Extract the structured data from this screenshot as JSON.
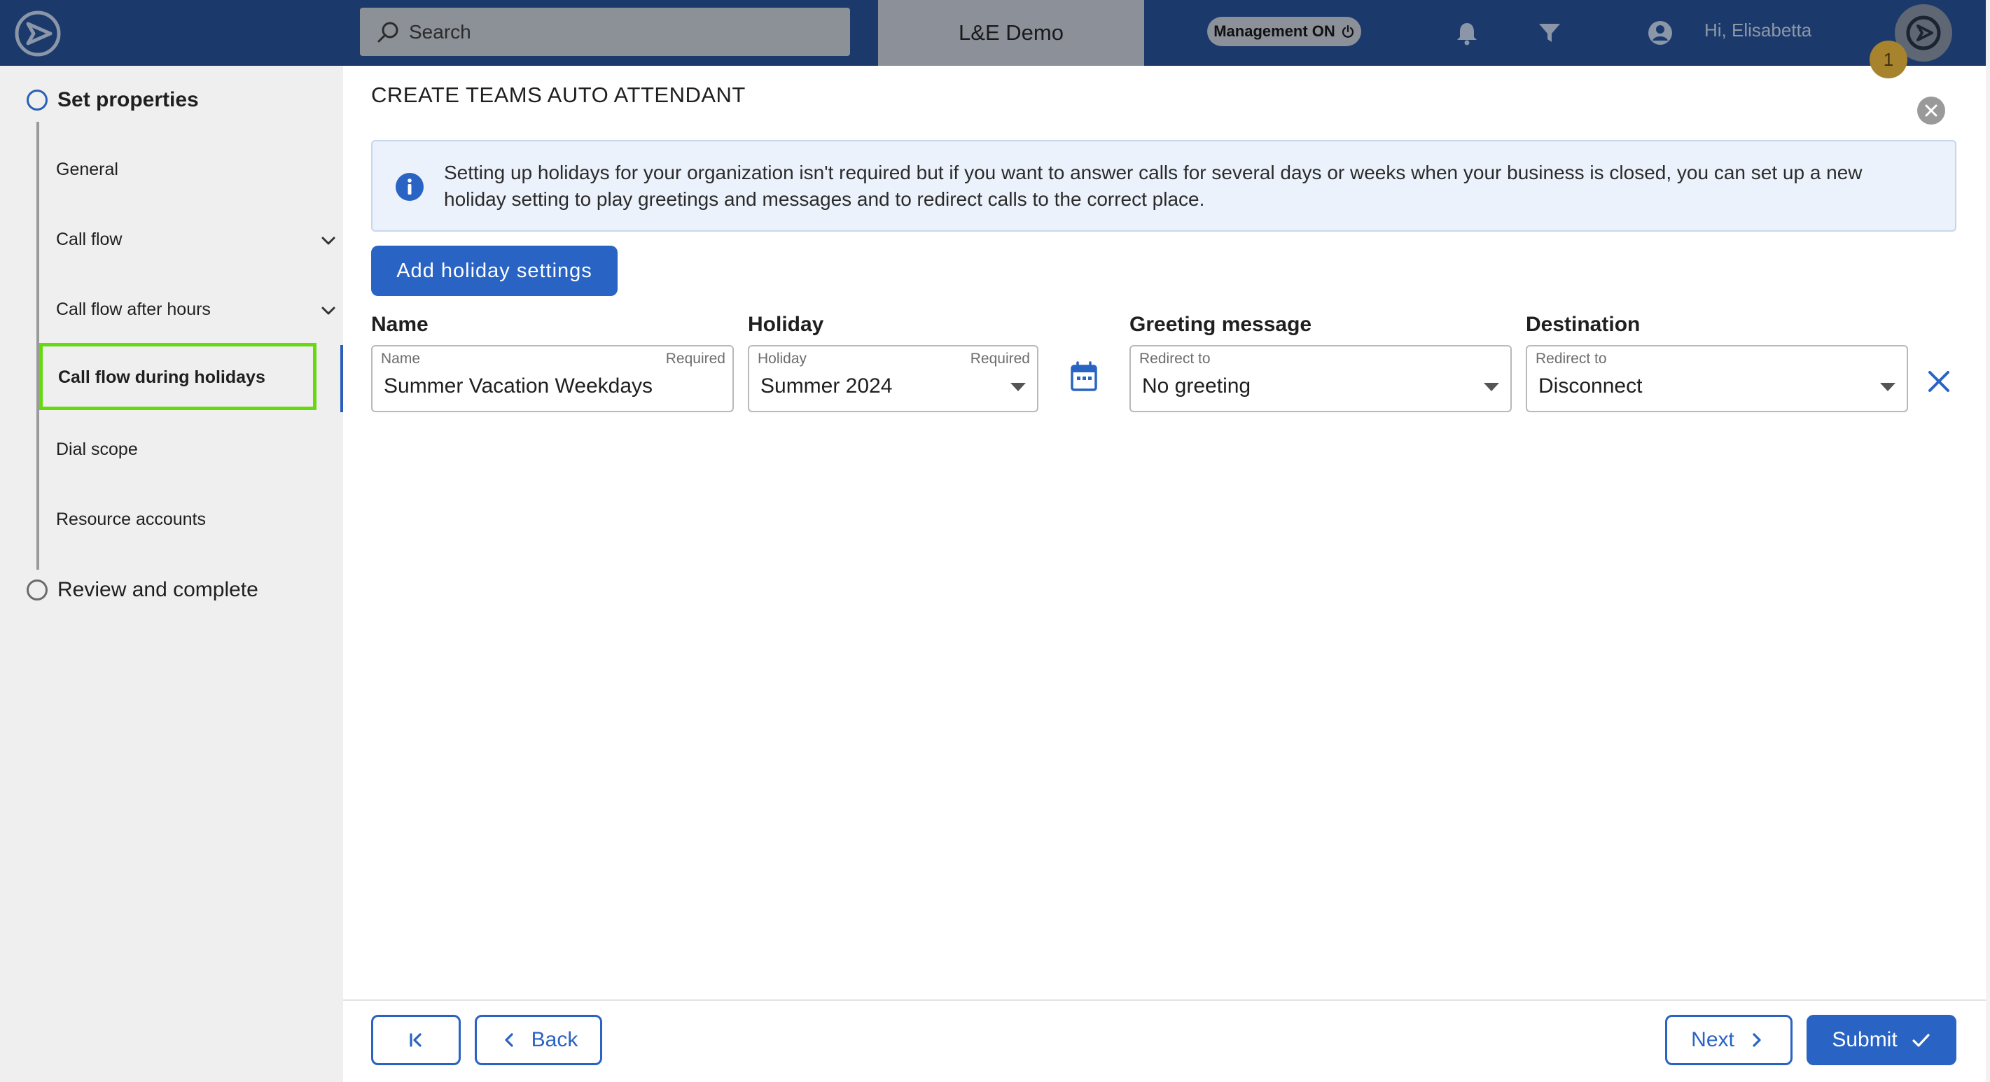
{
  "header": {
    "search_placeholder": "Search",
    "tenant_name": "L&E Demo",
    "management_label": "Management ON",
    "greeting": "Hi, Elisabetta",
    "notification_count": "1"
  },
  "sidebar": {
    "steps": [
      {
        "label": "Set properties",
        "active": true
      },
      {
        "label": "Review and complete",
        "active": false
      }
    ],
    "items": [
      {
        "label": "General"
      },
      {
        "label": "Call flow",
        "expandable": true
      },
      {
        "label": "Call flow after hours",
        "expandable": true
      },
      {
        "label": "Call flow during holidays",
        "selected": true
      },
      {
        "label": "Dial scope"
      },
      {
        "label": "Resource accounts"
      }
    ]
  },
  "main": {
    "title": "CREATE TEAMS AUTO ATTENDANT",
    "info_text": "Setting up holidays for your organization isn't required but if you want to answer calls for several days or weeks when your business is closed, you can set up a new holiday setting to play greetings and messages and to redirect calls to the correct place.",
    "add_button_label": "Add holiday settings",
    "columns": {
      "name": "Name",
      "holiday": "Holiday",
      "greeting": "Greeting message",
      "destination": "Destination"
    },
    "row": {
      "name": {
        "label": "Name",
        "required": "Required",
        "value": "Summer Vacation Weekdays"
      },
      "holiday": {
        "label": "Holiday",
        "required": "Required",
        "value": "Summer 2024"
      },
      "greeting": {
        "label": "Redirect to",
        "value": "No greeting"
      },
      "destination": {
        "label": "Redirect to",
        "value": "Disconnect"
      }
    }
  },
  "footer": {
    "back_label": "Back",
    "next_label": "Next",
    "submit_label": "Submit"
  },
  "colors": {
    "topbar": "#1b3a6b",
    "accent": "#2963c3",
    "highlight": "#66d90f",
    "sidebar_bg": "#efefef"
  },
  "icons": [
    "app-logo-icon",
    "search-icon",
    "power-icon",
    "bell-icon",
    "filter-icon",
    "user-icon",
    "avatar-logo-icon",
    "chevron-down-icon",
    "close-icon",
    "info-icon",
    "calendar-icon",
    "remove-icon",
    "first-page-icon",
    "chevron-left-icon",
    "chevron-right-icon",
    "check-icon"
  ]
}
